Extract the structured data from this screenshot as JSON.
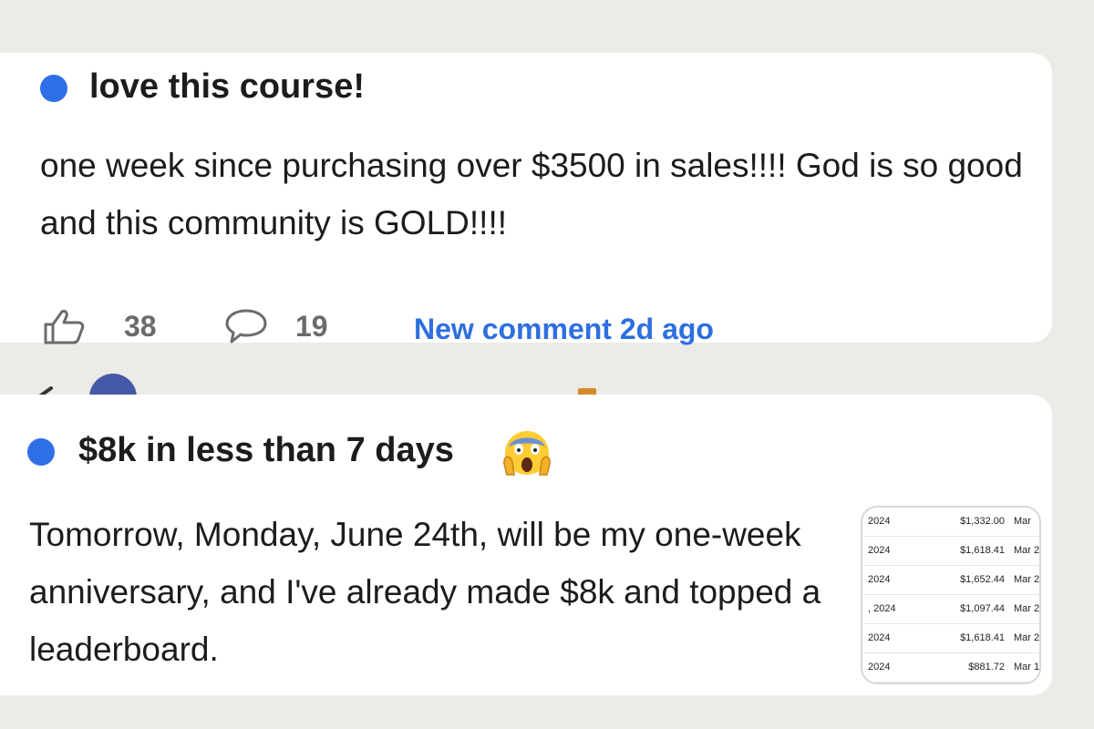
{
  "post1": {
    "title": "love this course!",
    "body": "one week since purchasing over $3500 in sales!!!! God is so good and this community is GOLD!!!!",
    "likes": "38",
    "comments": "19",
    "new_comment": "New comment 2d ago",
    "accent_color": "#2f6fe8"
  },
  "post2": {
    "title": "$8k in less than 7 days",
    "title_emoji": "screaming-face-emoji",
    "body": "Tomorrow, Monday, June 24th, will be my one-week anniversary, and I've already made $8k and topped a leaderboard.",
    "thumbnail": {
      "rows": [
        {
          "year": "2024",
          "amount": "$1,332.00",
          "month": "Mar"
        },
        {
          "year": "2024",
          "amount": "$1,618.41",
          "month": "Mar 2"
        },
        {
          "year": "2024",
          "amount": "$1,652.44",
          "month": "Mar 2"
        },
        {
          "year": ", 2024",
          "amount": "$1,097.44",
          "month": "Mar 2"
        },
        {
          "year": "2024",
          "amount": "$1,618.41",
          "month": "Mar 2"
        },
        {
          "year": "2024",
          "amount": "$881.72",
          "month": "Mar 1"
        }
      ]
    }
  },
  "icons": {
    "like": "thumbs-up-icon",
    "comment": "comment-bubble-icon"
  }
}
